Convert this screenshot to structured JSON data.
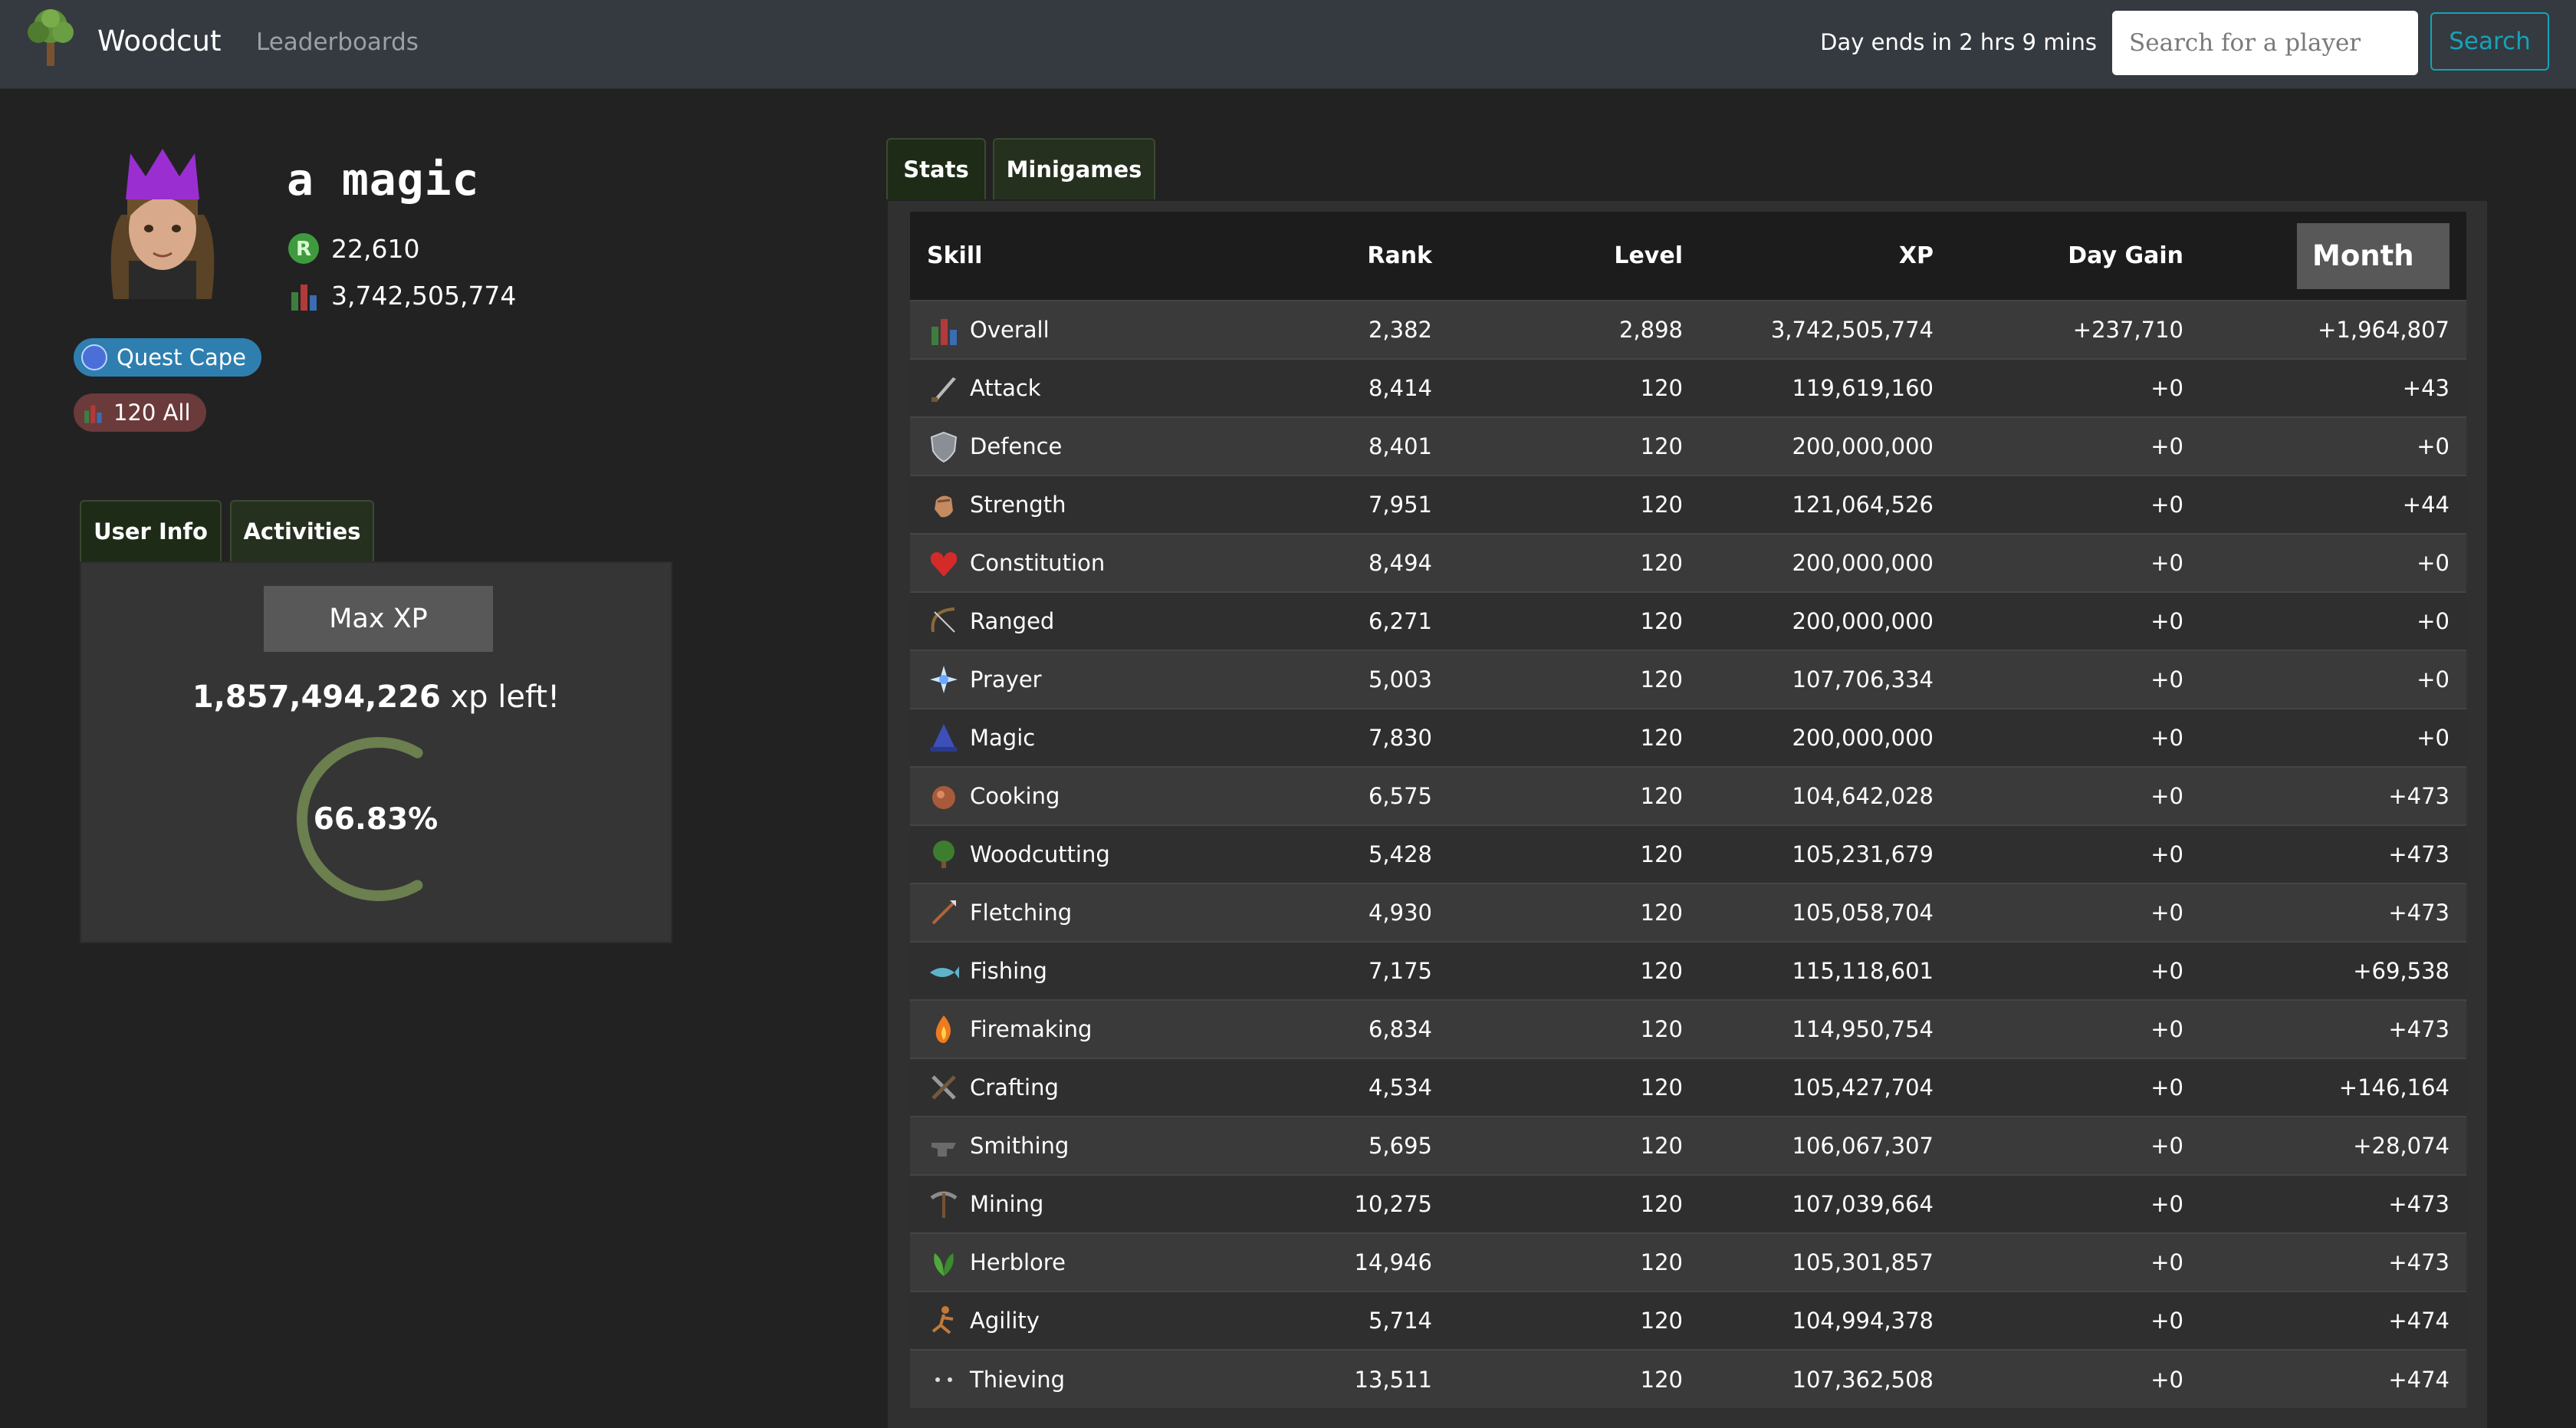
{
  "navbar": {
    "brand": "Woodcut",
    "link_leaderboards": "Leaderboards",
    "day_ends": "Day ends in 2 hrs 9 mins",
    "search_placeholder": "Search for a player",
    "search_button": "Search"
  },
  "player": {
    "name": "a magic",
    "runescore": "22,610",
    "total_xp": "3,742,505,774",
    "badges": [
      {
        "label": "Quest Cape",
        "color": "#2e7fb0"
      },
      {
        "label": "120 All",
        "color": "#6b3a3a"
      }
    ]
  },
  "left_tabs": [
    "User Info",
    "Activities"
  ],
  "max_xp": {
    "button": "Max XP",
    "xp_remaining": "1,857,494,226",
    "xp_suffix": "xp left!",
    "percent_label": "66.83%",
    "progress": 0.6683
  },
  "stats_tabs": [
    "Stats",
    "Minigames"
  ],
  "table": {
    "headers": [
      "Skill",
      "Rank",
      "Level",
      "XP",
      "Day Gain"
    ],
    "period_button": "Month",
    "rows": [
      {
        "skill": "Overall",
        "icon": "overall-icon",
        "rank": "2,382",
        "level": "2,898",
        "xp": "3,742,505,774",
        "day": "+237,710",
        "period": "+1,964,807"
      },
      {
        "skill": "Attack",
        "icon": "attack-icon",
        "rank": "8,414",
        "level": "120",
        "xp": "119,619,160",
        "day": "+0",
        "period": "+43"
      },
      {
        "skill": "Defence",
        "icon": "defence-icon",
        "rank": "8,401",
        "level": "120",
        "xp": "200,000,000",
        "day": "+0",
        "period": "+0"
      },
      {
        "skill": "Strength",
        "icon": "strength-icon",
        "rank": "7,951",
        "level": "120",
        "xp": "121,064,526",
        "day": "+0",
        "period": "+44"
      },
      {
        "skill": "Constitution",
        "icon": "constitution-icon",
        "rank": "8,494",
        "level": "120",
        "xp": "200,000,000",
        "day": "+0",
        "period": "+0"
      },
      {
        "skill": "Ranged",
        "icon": "ranged-icon",
        "rank": "6,271",
        "level": "120",
        "xp": "200,000,000",
        "day": "+0",
        "period": "+0"
      },
      {
        "skill": "Prayer",
        "icon": "prayer-icon",
        "rank": "5,003",
        "level": "120",
        "xp": "107,706,334",
        "day": "+0",
        "period": "+0"
      },
      {
        "skill": "Magic",
        "icon": "magic-icon",
        "rank": "7,830",
        "level": "120",
        "xp": "200,000,000",
        "day": "+0",
        "period": "+0"
      },
      {
        "skill": "Cooking",
        "icon": "cooking-icon",
        "rank": "6,575",
        "level": "120",
        "xp": "104,642,028",
        "day": "+0",
        "period": "+473"
      },
      {
        "skill": "Woodcutting",
        "icon": "woodcutting-icon",
        "rank": "5,428",
        "level": "120",
        "xp": "105,231,679",
        "day": "+0",
        "period": "+473"
      },
      {
        "skill": "Fletching",
        "icon": "fletching-icon",
        "rank": "4,930",
        "level": "120",
        "xp": "105,058,704",
        "day": "+0",
        "period": "+473"
      },
      {
        "skill": "Fishing",
        "icon": "fishing-icon",
        "rank": "7,175",
        "level": "120",
        "xp": "115,118,601",
        "day": "+0",
        "period": "+69,538"
      },
      {
        "skill": "Firemaking",
        "icon": "firemaking-icon",
        "rank": "6,834",
        "level": "120",
        "xp": "114,950,754",
        "day": "+0",
        "period": "+473"
      },
      {
        "skill": "Crafting",
        "icon": "crafting-icon",
        "rank": "4,534",
        "level": "120",
        "xp": "105,427,704",
        "day": "+0",
        "period": "+146,164"
      },
      {
        "skill": "Smithing",
        "icon": "smithing-icon",
        "rank": "5,695",
        "level": "120",
        "xp": "106,067,307",
        "day": "+0",
        "period": "+28,074"
      },
      {
        "skill": "Mining",
        "icon": "mining-icon",
        "rank": "10,275",
        "level": "120",
        "xp": "107,039,664",
        "day": "+0",
        "period": "+473"
      },
      {
        "skill": "Herblore",
        "icon": "herblore-icon",
        "rank": "14,946",
        "level": "120",
        "xp": "105,301,857",
        "day": "+0",
        "period": "+473"
      },
      {
        "skill": "Agility",
        "icon": "agility-icon",
        "rank": "5,714",
        "level": "120",
        "xp": "104,994,378",
        "day": "+0",
        "period": "+474"
      },
      {
        "skill": "Thieving",
        "icon": "thieving-icon",
        "rank": "13,511",
        "level": "120",
        "xp": "107,362,508",
        "day": "+0",
        "period": "+474"
      }
    ]
  },
  "colors": {
    "gain_positive": "#5fd35f",
    "gain_zero": "#b5b5b5",
    "progress_ring": "#6b7f4f",
    "link_accent": "#17a2b8"
  }
}
